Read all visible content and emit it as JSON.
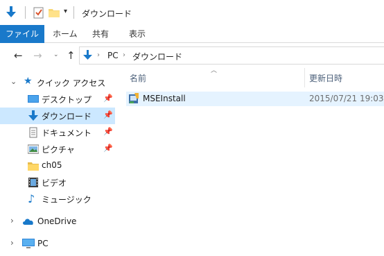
{
  "window": {
    "title": "ダウンロード"
  },
  "ribbon": {
    "file_tab": "ファイル",
    "tabs": [
      "ホーム",
      "共有",
      "表示"
    ]
  },
  "address": {
    "segments": [
      "PC",
      "ダウンロード"
    ]
  },
  "sidebar": {
    "quick_access": "クイック アクセス",
    "items": [
      {
        "label": "デスクトップ",
        "icon": "desktop-icon",
        "pinned": true
      },
      {
        "label": "ダウンロード",
        "icon": "download-arrow-icon",
        "pinned": true,
        "selected": true
      },
      {
        "label": "ドキュメント",
        "icon": "document-icon",
        "pinned": true
      },
      {
        "label": "ピクチャ",
        "icon": "picture-icon",
        "pinned": true
      },
      {
        "label": "ch05",
        "icon": "folder-icon",
        "pinned": false
      },
      {
        "label": "ビデオ",
        "icon": "video-icon",
        "pinned": false
      },
      {
        "label": "ミュージック",
        "icon": "music-icon",
        "pinned": false
      }
    ],
    "onedrive": "OneDrive",
    "pc": "PC"
  },
  "content": {
    "columns": {
      "name": "名前",
      "modified": "更新日時"
    },
    "files": [
      {
        "name": "MSEInstall",
        "modified": "2015/07/21 19:03"
      }
    ]
  },
  "colors": {
    "accent": "#1979ca",
    "selection": "#cce8ff",
    "hover_row": "#e5f3ff"
  }
}
